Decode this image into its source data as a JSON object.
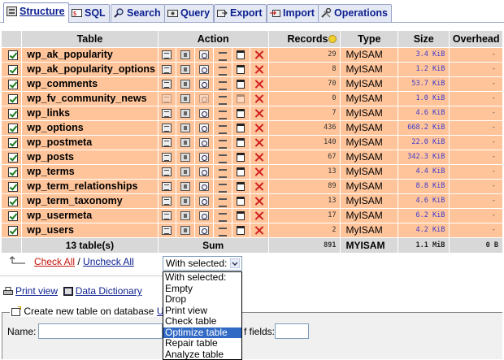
{
  "tabs": [
    {
      "label": "Structure",
      "icon": "structure-icon",
      "active": true
    },
    {
      "label": "SQL",
      "icon": "sql-icon",
      "active": false
    },
    {
      "label": "Search",
      "icon": "search-icon",
      "active": false
    },
    {
      "label": "Query",
      "icon": "query-icon",
      "active": false
    },
    {
      "label": "Export",
      "icon": "export-icon",
      "active": false
    },
    {
      "label": "Import",
      "icon": "import-icon",
      "active": false
    },
    {
      "label": "Operations",
      "icon": "operations-icon",
      "active": false
    }
  ],
  "table": {
    "headers": {
      "table": "Table",
      "action": "Action",
      "records": "Records",
      "type": "Type",
      "size": "Size",
      "overhead": "Overhead"
    },
    "rows": [
      {
        "name": "wp_ak_popularity",
        "records": "29",
        "type": "MyISAM",
        "size": "3.4 KiB",
        "overhead": "-",
        "empty": false
      },
      {
        "name": "wp_ak_popularity_options",
        "records": "8",
        "type": "MyISAM",
        "size": "1.2 KiB",
        "overhead": "-",
        "empty": false
      },
      {
        "name": "wp_comments",
        "records": "70",
        "type": "MyISAM",
        "size": "53.7 KiB",
        "overhead": "-",
        "empty": false
      },
      {
        "name": "wp_fv_community_news",
        "records": "0",
        "type": "MyISAM",
        "size": "1.0 KiB",
        "overhead": "-",
        "empty": true
      },
      {
        "name": "wp_links",
        "records": "7",
        "type": "MyISAM",
        "size": "4.6 KiB",
        "overhead": "-",
        "empty": false
      },
      {
        "name": "wp_options",
        "records": "436",
        "type": "MyISAM",
        "size": "668.2 KiB",
        "overhead": "-",
        "empty": false
      },
      {
        "name": "wp_postmeta",
        "records": "140",
        "type": "MyISAM",
        "size": "22.0 KiB",
        "overhead": "-",
        "empty": false
      },
      {
        "name": "wp_posts",
        "records": "67",
        "type": "MyISAM",
        "size": "342.3 KiB",
        "overhead": "-",
        "empty": false
      },
      {
        "name": "wp_terms",
        "records": "13",
        "type": "MyISAM",
        "size": "4.4 KiB",
        "overhead": "-",
        "empty": false
      },
      {
        "name": "wp_term_relationships",
        "records": "89",
        "type": "MyISAM",
        "size": "8.8 KiB",
        "overhead": "-",
        "empty": false
      },
      {
        "name": "wp_term_taxonomy",
        "records": "13",
        "type": "MyISAM",
        "size": "4.6 KiB",
        "overhead": "-",
        "empty": false
      },
      {
        "name": "wp_usermeta",
        "records": "17",
        "type": "MyISAM",
        "size": "6.2 KiB",
        "overhead": "-",
        "empty": false
      },
      {
        "name": "wp_users",
        "records": "2",
        "type": "MyISAM",
        "size": "4.2 KiB",
        "overhead": "-",
        "empty": false
      }
    ],
    "footer": {
      "count": "13 table(s)",
      "sum": "Sum",
      "records": "891",
      "type": "MYISAM",
      "size": "1.1 MiB",
      "overhead": "0 B"
    }
  },
  "controls": {
    "check_all": "Check All",
    "separator": " / ",
    "uncheck_all": "Uncheck All",
    "with_selected": "With selected:",
    "options": [
      "With selected:",
      "Empty",
      "Drop",
      "Print view",
      "Check table",
      "Optimize table",
      "Repair table",
      "Analyze table"
    ],
    "highlighted_option": "Optimize table"
  },
  "links": {
    "print_view": "Print view",
    "data_dictionary": "Data Dictionary"
  },
  "create": {
    "legend": "Create new table on database",
    "db_fragment": "U",
    "name_label": "Name:",
    "fields_label_fragment": "f fields:"
  },
  "colors": {
    "row_bg": "#ffc49a",
    "header_bg": "#d8d8d8",
    "tab_text": "#0b1f8f",
    "drop_red": "#d02020",
    "check_all_red": "#c4120b",
    "selected_option": "#316ac5"
  }
}
